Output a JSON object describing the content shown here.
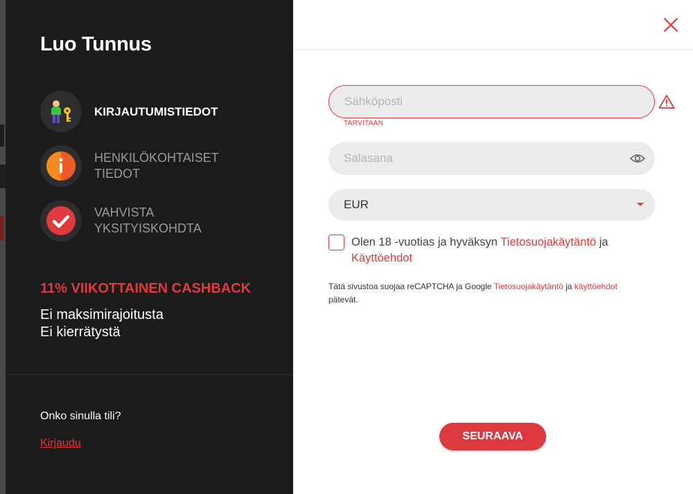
{
  "sidebar": {
    "title": "Luo Tunnus",
    "steps": [
      {
        "label": "KIRJAUTUMISTIEDOT",
        "icon": "user-key-icon",
        "state": "active"
      },
      {
        "label": "HENKILÖKOHTAISET TIEDOT",
        "icon": "info-icon",
        "state": "inactive"
      },
      {
        "label": "VAHVISTA YKSITYISKOHDTA",
        "icon": "check-icon",
        "state": "inactive"
      }
    ],
    "cashback_title": "11% VIIKOTTAINEN CASHBACK",
    "perks": [
      "Ei maksimirajoitusta",
      "Ei kierrätystä"
    ],
    "have_account": "Onko sinulla tili?",
    "login_link": "Kirjaudu"
  },
  "form": {
    "email": {
      "placeholder": "Sähköposti",
      "value": "",
      "error": "TARVITAAN"
    },
    "password": {
      "placeholder": "Salasana",
      "value": ""
    },
    "currency": {
      "selected": "EUR"
    },
    "terms": {
      "prefix": "Olen 18 -vuotias ja hyväksyn ",
      "privacy_link": "Tietosuojakäytäntö",
      "middle": " ja ",
      "terms_link": "Käyttöehdot"
    },
    "recaptcha": {
      "prefix": "Tätä sivustoa suojaa reCAPTCHA ja Google ",
      "privacy_link": "Tietosuojakäytäntö",
      "middle": " ja ",
      "terms_link": "käyttöehdot",
      "suffix": " pätevät."
    },
    "next_button": "SEURAAVA"
  },
  "colors": {
    "accent": "#e0393e",
    "panel_dark": "#1b1b1b",
    "field_bg": "#ebebeb"
  }
}
